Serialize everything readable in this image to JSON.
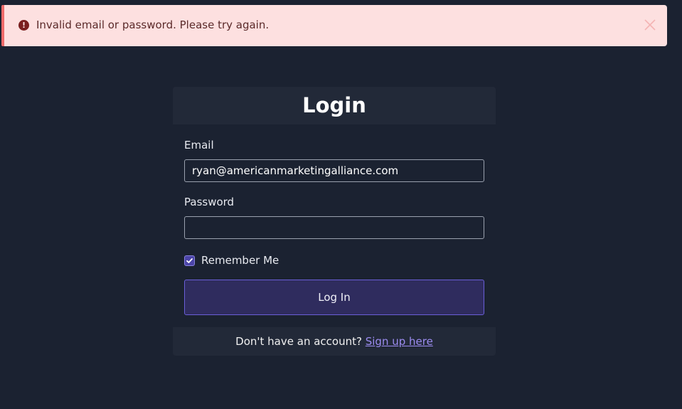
{
  "alert": {
    "message": "Invalid email or password. Please try again.",
    "icon": "exclamation-icon",
    "close_icon": "close-icon",
    "background": "#fde0e0",
    "accent": "#ef6a6a"
  },
  "login": {
    "title": "Login",
    "email_label": "Email",
    "email_value": "ryan@americanmarketingalliance.com",
    "password_label": "Password",
    "password_value": "",
    "remember_label": "Remember Me",
    "remember_checked": true,
    "submit_label": "Log In",
    "footer_text": "Don't have an account?",
    "signup_link": "Sign up here"
  },
  "colors": {
    "page_background": "#1b2231",
    "button_border": "#6a5fd8",
    "link": "#9c8cf0"
  }
}
